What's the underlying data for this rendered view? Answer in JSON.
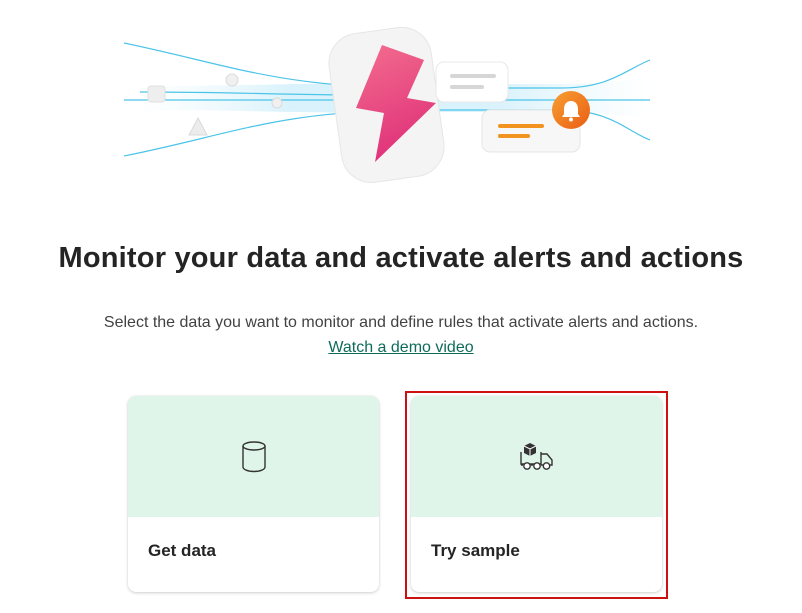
{
  "header": {
    "title": "Monitor your data and activate alerts and actions",
    "subtitle": "Select the data you want to monitor and define rules that activate alerts and actions.",
    "demo_link": "Watch a demo video"
  },
  "cards": [
    {
      "label": "Get data",
      "icon": "database-icon"
    },
    {
      "label": "Try sample",
      "icon": "delivery-truck-icon"
    }
  ],
  "colors": {
    "card_top": "#e0f5ea",
    "link": "#0e6b5b",
    "highlight": "#cc1111",
    "bolt": "#e8407a",
    "bell": "#f07a1a"
  }
}
